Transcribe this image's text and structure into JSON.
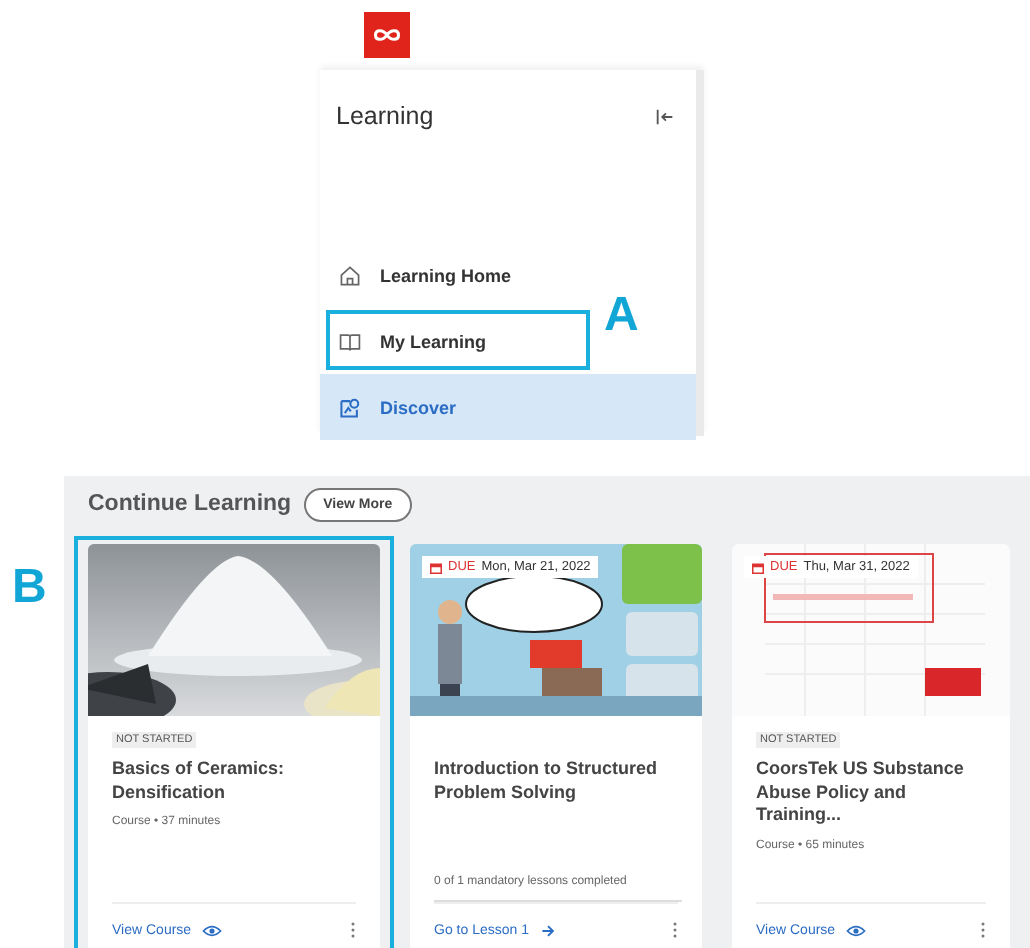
{
  "sidebar": {
    "title": "Learning",
    "items": [
      {
        "label": "Learning Home",
        "selected": false
      },
      {
        "label": "My Learning",
        "selected": false
      },
      {
        "label": "Discover",
        "selected": true
      }
    ]
  },
  "callouts": [
    {
      "label": "A"
    },
    {
      "label": "B"
    }
  ],
  "continue_learning": {
    "title": "Continue Learning",
    "button": "View More",
    "cards": [
      {
        "kind": "course",
        "status": "NOT STARTED",
        "title": "Basics of Ceramics: Densification",
        "meta": "Course • 37 minutes",
        "action": "View Course"
      },
      {
        "kind": "lesson",
        "due": {
          "label": "DUE",
          "date": "Mon, Mar 21, 2022"
        },
        "title": "Introduction to Structured Problem Solving",
        "progress": "0 of 1 mandatory lessons completed",
        "action": "Go to Lesson 1"
      },
      {
        "kind": "course",
        "due": {
          "label": "DUE",
          "date": "Thu, Mar 31, 2022"
        },
        "status": "NOT STARTED",
        "title": "CoorsTek US Substance Abuse Policy and Training...",
        "meta": "Course • 65 minutes",
        "action": "View Course"
      }
    ]
  }
}
